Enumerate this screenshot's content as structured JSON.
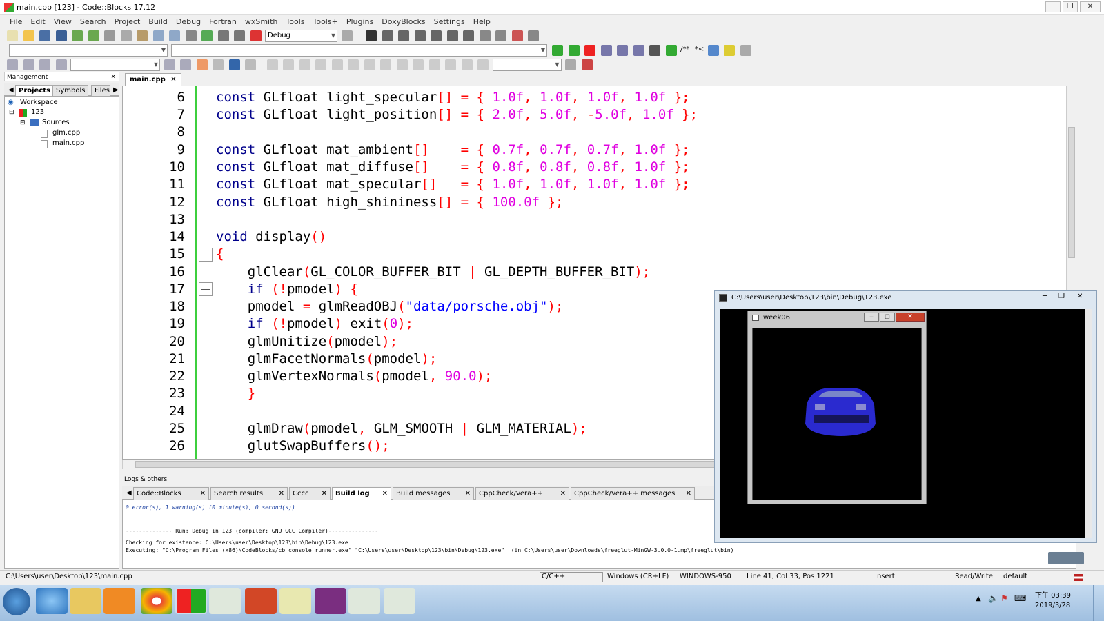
{
  "window": {
    "title": "main.cpp [123] - Code::Blocks 17.12"
  },
  "menu": [
    "File",
    "Edit",
    "View",
    "Search",
    "Project",
    "Build",
    "Debug",
    "Fortran",
    "wxSmith",
    "Tools",
    "Tools+",
    "Plugins",
    "DoxyBlocks",
    "Settings",
    "Help"
  ],
  "toolbar": {
    "build_target": "Debug",
    "comment_label": "/**",
    "comment2_label": "*<"
  },
  "management": {
    "title": "Management",
    "tabs": [
      "Projects",
      "Symbols",
      "Files"
    ],
    "tree": {
      "workspace": "Workspace",
      "project": "123",
      "folder": "Sources",
      "files": [
        "glm.cpp",
        "main.cpp"
      ]
    }
  },
  "editor": {
    "tab": "main.cpp",
    "line_numbers": [
      "6",
      "7",
      "8",
      "9",
      "10",
      "11",
      "12",
      "13",
      "14",
      "15",
      "16",
      "17",
      "18",
      "19",
      "20",
      "21",
      "22",
      "23",
      "24",
      "25",
      "26"
    ]
  },
  "logs": {
    "title": "Logs & others",
    "tabs": [
      "Code::Blocks",
      "Search results",
      "Cccc",
      "Build log",
      "Build messages",
      "CppCheck/Vera++",
      "CppCheck/Vera++ messages"
    ],
    "active_tab": "Build log",
    "lines": [
      "0 error(s), 1 warning(s) (0 minute(s), 0 second(s))",
      "",
      "",
      "-------------- Run: Debug in 123 (compiler: GNU GCC Compiler)---------------",
      "Checking for existence: C:\\Users\\user\\Desktop\\123\\bin\\Debug\\123.exe",
      "Executing: \"C:\\Program Files (x86)\\CodeBlocks/cb_console_runner.exe\" \"C:\\Users\\user\\Desktop\\123\\bin\\Debug\\123.exe\"  (in C:\\Users\\user\\Downloads\\freeglut-MinGW-3.0.0-1.mp\\freeglut\\bin)"
    ]
  },
  "status": {
    "path": "C:\\Users\\user\\Desktop\\123\\main.cpp",
    "lang": "C/C++",
    "eol": "Windows (CR+LF)",
    "encoding": "WINDOWS-950",
    "position": "Line 41, Col 33, Pos 1221",
    "mode": "Insert",
    "access": "Read/Write",
    "theme": "default"
  },
  "console": {
    "title": "C:\\Users\\user\\Desktop\\123\\bin\\Debug\\123.exe"
  },
  "glwindow": {
    "title": "week06"
  },
  "taskbar": {
    "time": "下午 03:39",
    "date": "2019/3/28"
  }
}
